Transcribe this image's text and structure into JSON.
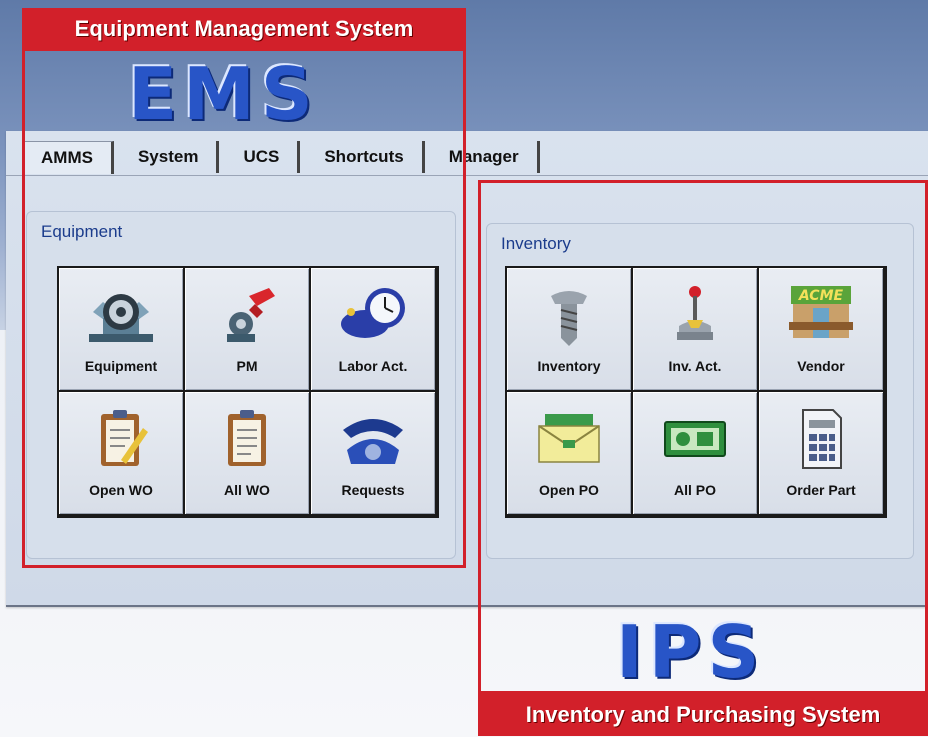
{
  "tabs": [
    "AMMS",
    "System",
    "UCS",
    "Shortcuts",
    "Manager"
  ],
  "ems": {
    "caption": "Equipment Management System",
    "acronym": "EMS",
    "group_title": "Equipment",
    "buttons": [
      {
        "label": "Equipment",
        "icon": "engine-icon"
      },
      {
        "label": "PM",
        "icon": "oil-can-icon"
      },
      {
        "label": "Labor Act.",
        "icon": "clock-icon"
      },
      {
        "label": "Open WO",
        "icon": "clipboard-pencil-icon"
      },
      {
        "label": "All WO",
        "icon": "clipboard-icon"
      },
      {
        "label": "Requests",
        "icon": "telephone-icon"
      }
    ]
  },
  "ips": {
    "caption": "Inventory and Purchasing System",
    "acronym": "IPS",
    "group_title": "Inventory",
    "buttons": [
      {
        "label": "Inventory",
        "icon": "screw-icon"
      },
      {
        "label": "Inv. Act.",
        "icon": "joystick-icon"
      },
      {
        "label": "Vendor",
        "icon": "acme-store-icon",
        "sign": "ACME"
      },
      {
        "label": "Open PO",
        "icon": "envelope-money-icon"
      },
      {
        "label": "All PO",
        "icon": "money-bill-icon"
      },
      {
        "label": "Order Part",
        "icon": "calculator-icon"
      }
    ]
  },
  "colors": {
    "accent_red": "#d2202a",
    "title_blue": "#1b3c8c",
    "acronym_blue": "#2855c7"
  }
}
